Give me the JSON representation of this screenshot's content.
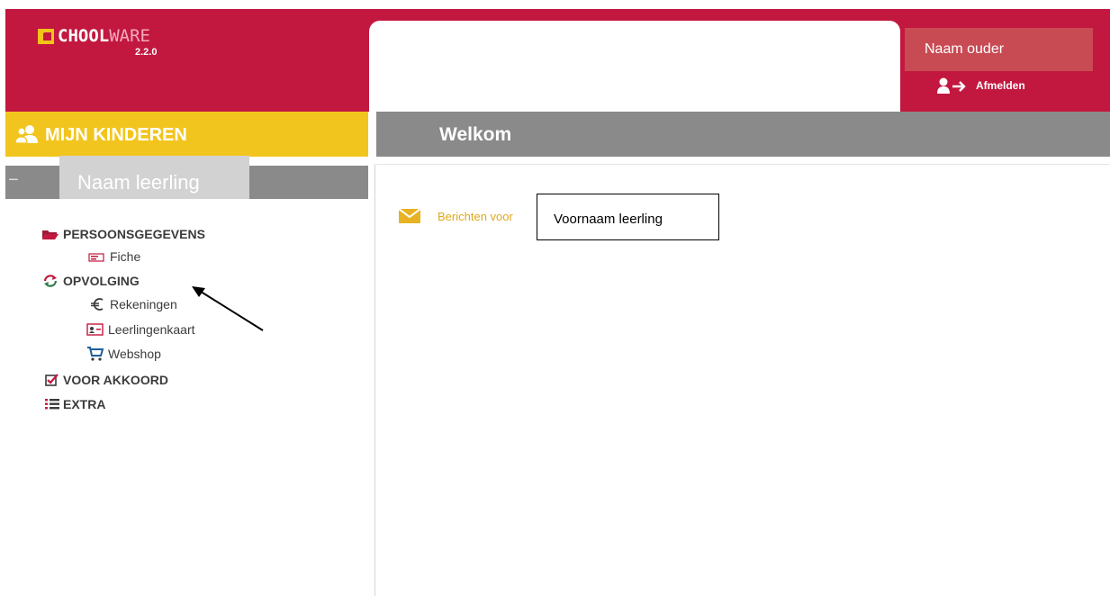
{
  "header": {
    "brand_strong": "CHOOL",
    "brand_light": "WARE",
    "version": "2.2.0",
    "parent_name": "Naam ouder",
    "logout_label": "Afmelden"
  },
  "sidebar": {
    "title": "MIJN KINDEREN",
    "collapse_symbol": "−",
    "student_name": "Naam leerling",
    "sections": [
      {
        "label": "PERSOONSGEGEVENS",
        "icon": "folder-open-icon"
      },
      {
        "label": "OPVOLGING",
        "icon": "refresh-icon"
      },
      {
        "label": "VOOR AKKOORD",
        "icon": "checkbox-icon"
      },
      {
        "label": "EXTRA",
        "icon": "list-icon"
      }
    ],
    "items": [
      {
        "label": "Fiche",
        "icon": "id-card-icon"
      },
      {
        "label": "Rekeningen",
        "icon": "euro-icon"
      },
      {
        "label": "Leerlingenkaart",
        "icon": "student-card-icon"
      },
      {
        "label": "Webshop",
        "icon": "cart-icon"
      }
    ]
  },
  "main": {
    "title": "Welkom",
    "messages_label": "Berichten voor",
    "student_firstname": "Voornaam leerling"
  },
  "colors": {
    "brand_red": "#c2183f",
    "accent_yellow": "#f2c51e",
    "bar_gray": "#8a8a8a",
    "link_gold": "#e0a81e"
  }
}
